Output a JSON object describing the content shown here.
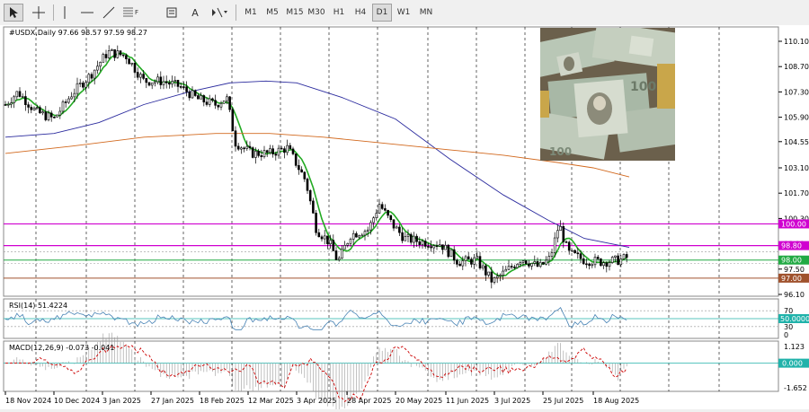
{
  "toolbar": {
    "tools": [
      "cursor-icon",
      "crosshair-icon",
      "vertical-line-icon",
      "horizontal-line-icon",
      "trendline-icon",
      "fibonacci-icon",
      "text-icon",
      "label-icon",
      "shapes-icon"
    ],
    "timeframes": [
      "M1",
      "M5",
      "M15",
      "M30",
      "H1",
      "H4",
      "D1",
      "W1",
      "MN"
    ],
    "selected_timeframe": "D1",
    "fib_label": "F",
    "text_label": "A"
  },
  "main_chart": {
    "symbol_header": "#USDX,Daily  97.66 98.57 97.59 98.27",
    "price_ticks": [
      "110.10",
      "108.70",
      "107.30",
      "105.90",
      "104.55",
      "103.10",
      "101.70",
      "100.30",
      "98.90",
      "97.50",
      "96.10"
    ],
    "level_labels": [
      {
        "text": "100.00",
        "color": "#d000d0"
      },
      {
        "text": "98.80",
        "color": "#d000d0"
      },
      {
        "text": "98.00",
        "color": "#22aa44"
      },
      {
        "text": "97.00",
        "color": "#a0522d"
      }
    ],
    "colors": {
      "sma_fast": "#22aa22",
      "sma_mid": "#2b2b9e",
      "sma_slow": "#d2691e",
      "candle": "#000000"
    }
  },
  "rsi_panel": {
    "header": "RSI(14) 51.4224",
    "ticks": [
      "70",
      "30",
      "0"
    ],
    "current_label": "50.0000",
    "line_color": "#4682b4"
  },
  "macd_panel": {
    "header": "MACD(12,26,9) -0.073 -0.041",
    "ticks": [
      "1.123",
      "-1.652"
    ],
    "current_label": "0.000",
    "signal_color": "#cc0000"
  },
  "date_axis": [
    "18 Nov 2024",
    "10 Dec 2024",
    "3 Jan 2025",
    "27 Jan 2025",
    "18 Feb 2025",
    "12 Mar 2025",
    "3 Apr 2025",
    "28 Apr 2025",
    "20 May 2025",
    "11 Jun 2025",
    "3 Jul 2025",
    "25 Jul 2025",
    "18 Aug 2025"
  ],
  "thumbnail": {
    "name": "dollar-banknotes-image"
  }
}
